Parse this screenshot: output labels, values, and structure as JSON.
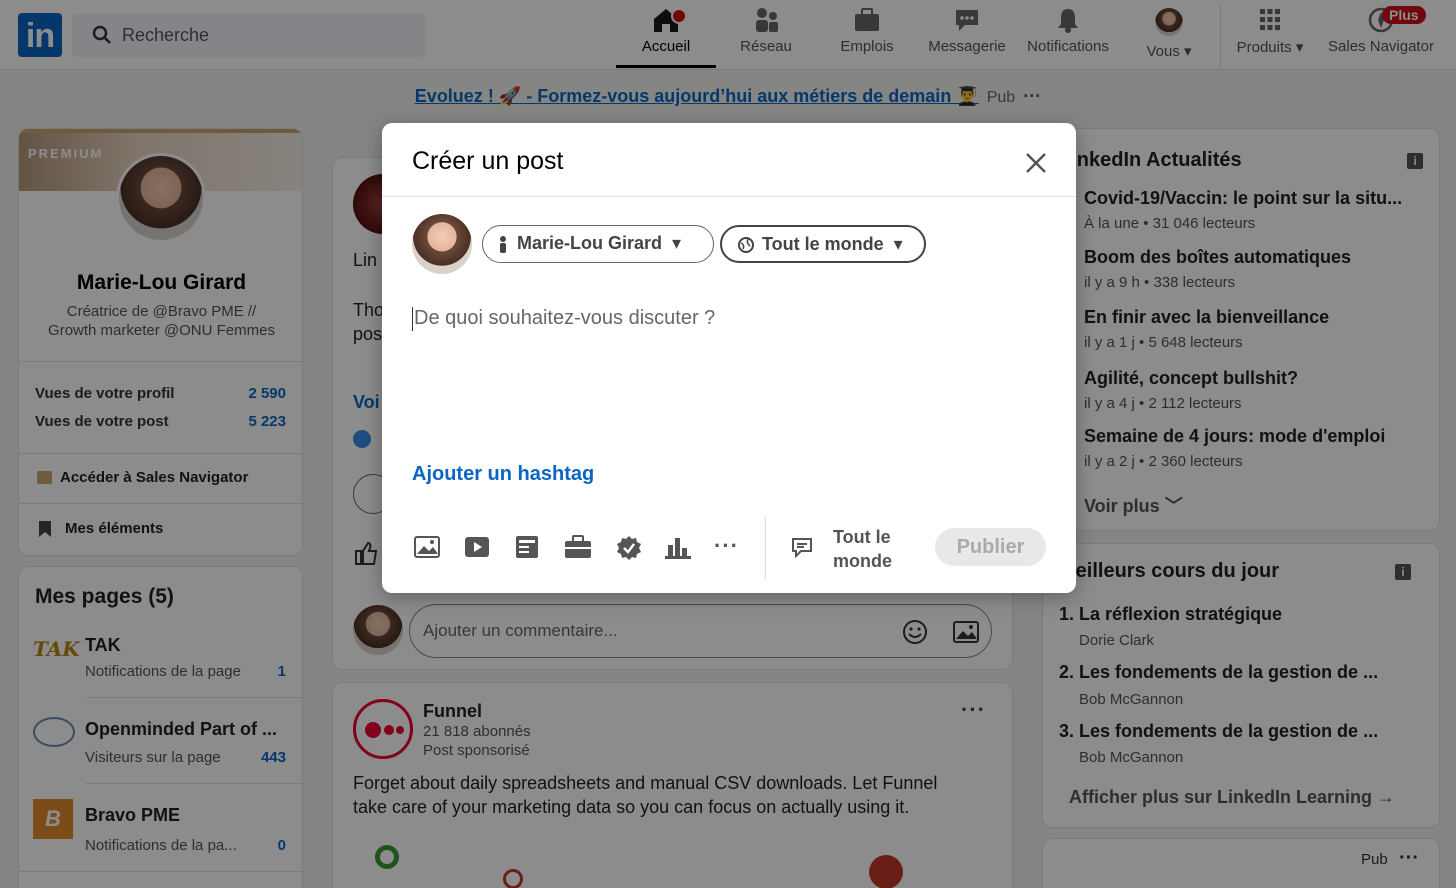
{
  "topbar": {
    "logo": "in",
    "search_placeholder": "Recherche",
    "nav": [
      {
        "label": "Accueil",
        "icon": "home-icon"
      },
      {
        "label": "Réseau",
        "icon": "network-icon"
      },
      {
        "label": "Emplois",
        "icon": "briefcase-icon"
      },
      {
        "label": "Messagerie",
        "icon": "messaging-icon"
      },
      {
        "label": "Notifications",
        "icon": "bell-icon"
      },
      {
        "label": "Vous",
        "icon": "avatar"
      },
      {
        "label": "Produits",
        "icon": "grid-icon"
      },
      {
        "label": "Sales Navigator",
        "icon": "compass-icon"
      }
    ],
    "plus_badge": "Plus"
  },
  "promo": {
    "text": "Evoluez ! 🚀 - Formez-vous aujourd’hui aux métiers de demain 👨‍🎓",
    "pub": "Pub"
  },
  "profile": {
    "premium": "PREMIUM",
    "name": "Marie-Lou Girard",
    "headline_1": "Créatrice de @Bravo PME //",
    "headline_2": "Growth marketer @ONU Femmes",
    "stats": [
      {
        "label": "Vues de votre profil",
        "value": "2 590"
      },
      {
        "label": "Vues de votre post",
        "value": "5 223"
      }
    ],
    "sales_nav": "Accéder à Sales Navigator",
    "my_items": "Mes éléments"
  },
  "pages": {
    "title": "Mes pages (5)",
    "items": [
      {
        "name": "TAK",
        "sub": "Notifications de la page",
        "count": "1"
      },
      {
        "name": "Openminded Part of ...",
        "sub": "Visiteurs sur la page",
        "count": "443"
      },
      {
        "name": "Bravo PME",
        "sub": "Notifications de la pa...",
        "count": "0"
      }
    ]
  },
  "feed": {
    "partial_1": "Lin",
    "partial_2": "Tho",
    "partial_3": "pos",
    "partial_4": "Voi",
    "comment_placeholder": "Ajouter un commentaire...",
    "funnel_name": "Funnel",
    "funnel_followers": "21 818 abonnés",
    "funnel_sponsored": "Post sponsorisé",
    "funnel_text_1": "Forget about daily spreadsheets and manual CSV downloads. Let Funnel",
    "funnel_text_2": "take care of your marketing data so you can focus on actually using it."
  },
  "news": {
    "title": "LinkedIn Actualités",
    "items": [
      {
        "headline": "Covid-19/Vaccin: le point sur la situ...",
        "meta": "À la une • 31 046 lecteurs"
      },
      {
        "headline": "Boom des boîtes automatiques",
        "meta": "il y a 9 h • 338 lecteurs"
      },
      {
        "headline": "En finir avec la bienveillance",
        "meta": "il y a 1 j • 5 648 lecteurs"
      },
      {
        "headline": "Agilité, concept bullshit?",
        "meta": "il y a 4 j • 2 112 lecteurs"
      },
      {
        "headline": "Semaine de 4 jours: mode d'emploi",
        "meta": "il y a 2 j • 2 360 lecteurs"
      }
    ],
    "more": "Voir plus"
  },
  "courses": {
    "title": "Meilleurs cours du jour",
    "items": [
      {
        "title": "1. La réflexion stratégique",
        "author": "Dorie Clark"
      },
      {
        "title": "2. Les fondements de la gestion de ...",
        "author": "Bob McGannon"
      },
      {
        "title": "3. Les fondements de la gestion de ...",
        "author": "Bob McGannon"
      }
    ],
    "more": "Afficher plus sur LinkedIn Learning →"
  },
  "ad_pub": "Pub",
  "modal": {
    "title": "Créer un post",
    "author": "Marie-Lou Girard",
    "audience": "Tout le monde",
    "placeholder": "De quoi souhaitez-vous discuter ?",
    "hashtag": "Ajouter un hashtag",
    "comment_scope_1": "Tout le",
    "comment_scope_2": "monde",
    "publish": "Publier"
  },
  "colors": {
    "brand": "#0a66c2",
    "alert": "#cc1016"
  }
}
